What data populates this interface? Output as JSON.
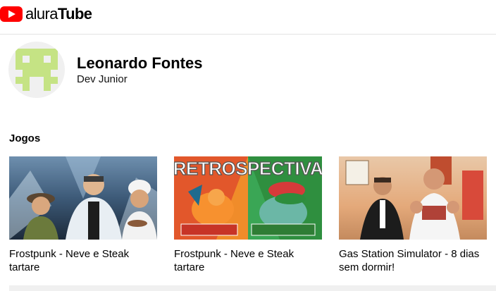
{
  "header": {
    "logo_icon": "play-logo-icon",
    "brand_first": "alura",
    "brand_second": "Tube",
    "brand_color": "#ff0000"
  },
  "profile": {
    "name": "Leonardo Fontes",
    "role": "Dev Junior",
    "avatar_colors": [
      "#c5e384",
      "#f0f0f0"
    ]
  },
  "section": {
    "title": "Jogos"
  },
  "videos": [
    {
      "title": "Frostpunk - Neve e Steak tartare"
    },
    {
      "title": "Frostpunk - Neve e Steak tartare"
    },
    {
      "title": "Gas Station Simulator - 8 dias sem dormir!"
    }
  ]
}
